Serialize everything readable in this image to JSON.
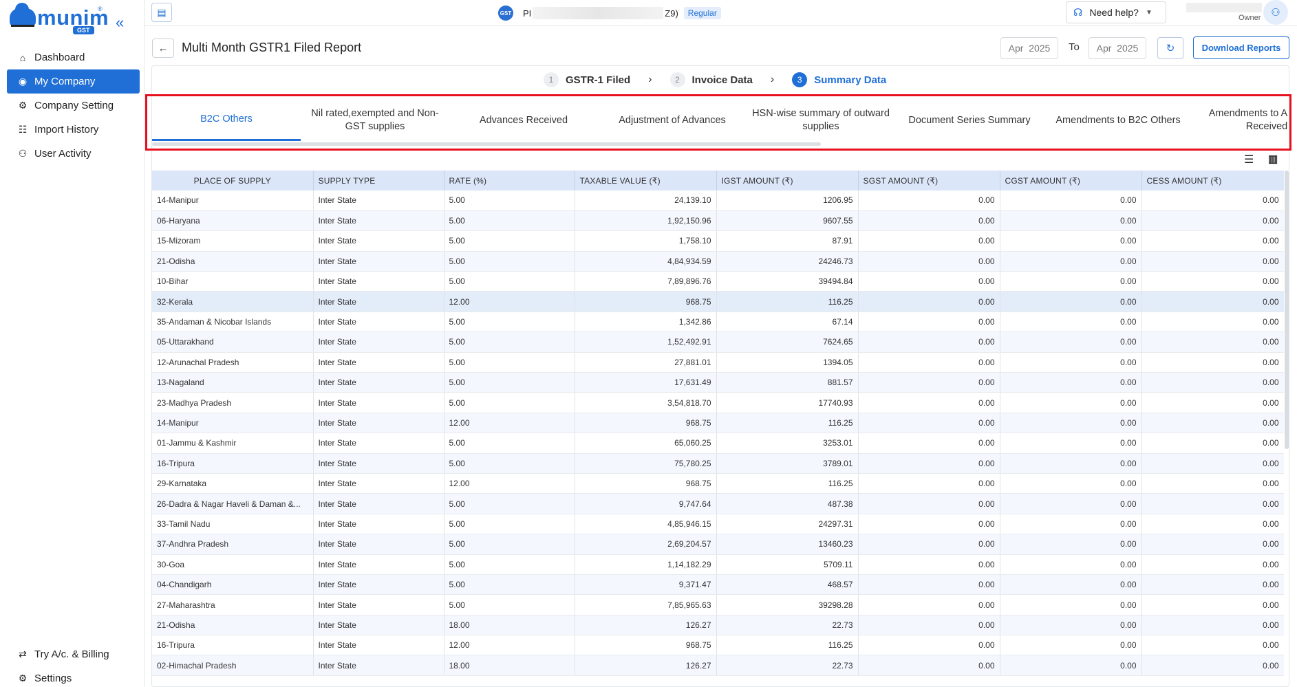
{
  "sidebar": {
    "logo_word": "munim",
    "logo_badge": "GST",
    "logo_reg": "®",
    "collapse_icon": "«",
    "items": [
      {
        "label": "Dashboard",
        "icon": "home-icon"
      },
      {
        "label": "My Company",
        "icon": "eye-icon",
        "active": true
      },
      {
        "label": "Company Setting",
        "icon": "gear-icon"
      },
      {
        "label": "Import History",
        "icon": "database-icon"
      },
      {
        "label": "User Activity",
        "icon": "users-icon"
      }
    ],
    "bottom_items": [
      {
        "label": "Try A/c. & Billing",
        "icon": "switch-icon"
      },
      {
        "label": "Settings",
        "icon": "gear-icon"
      }
    ]
  },
  "topbar": {
    "company_prefix": "PI",
    "company_suffix": "Z9)",
    "badge": "Regular",
    "help_label": "Need help?",
    "role": "Owner"
  },
  "header": {
    "title": "Multi Month GSTR1 Filed Report",
    "from_month": "Apr",
    "from_year": "2025",
    "to_label": "To",
    "to_month": "Apr",
    "to_year": "2025",
    "download_label": "Download Reports"
  },
  "steps": [
    {
      "num": "1",
      "label": "GSTR-1 Filed"
    },
    {
      "num": "2",
      "label": "Invoice Data"
    },
    {
      "num": "3",
      "label": "Summary Data",
      "active": true
    }
  ],
  "tabs": [
    {
      "label": "B2C Others",
      "active": true
    },
    {
      "label": "Nil rated,exempted and Non-GST supplies"
    },
    {
      "label": "Advances Received"
    },
    {
      "label": "Adjustment of Advances"
    },
    {
      "label": "HSN-wise summary of outward supplies"
    },
    {
      "label": "Document Series Summary"
    },
    {
      "label": "Amendments to B2C Others"
    },
    {
      "label": "Amendments to Advances Received"
    }
  ],
  "table": {
    "columns": [
      "PLACE OF SUPPLY",
      "SUPPLY TYPE",
      "RATE (%)",
      "TAXABLE VALUE (₹)",
      "IGST AMOUNT (₹)",
      "SGST AMOUNT (₹)",
      "CGST AMOUNT (₹)",
      "CESS AMOUNT (₹)"
    ],
    "rows": [
      [
        "14-Manipur",
        "Inter State",
        "5.00",
        "24,139.10",
        "1206.95",
        "0.00",
        "0.00",
        "0.00"
      ],
      [
        "06-Haryana",
        "Inter State",
        "5.00",
        "1,92,150.96",
        "9607.55",
        "0.00",
        "0.00",
        "0.00"
      ],
      [
        "15-Mizoram",
        "Inter State",
        "5.00",
        "1,758.10",
        "87.91",
        "0.00",
        "0.00",
        "0.00"
      ],
      [
        "21-Odisha",
        "Inter State",
        "5.00",
        "4,84,934.59",
        "24246.73",
        "0.00",
        "0.00",
        "0.00"
      ],
      [
        "10-Bihar",
        "Inter State",
        "5.00",
        "7,89,896.76",
        "39494.84",
        "0.00",
        "0.00",
        "0.00"
      ],
      [
        "32-Kerala",
        "Inter State",
        "12.00",
        "968.75",
        "116.25",
        "0.00",
        "0.00",
        "0.00"
      ],
      [
        "35-Andaman & Nicobar Islands",
        "Inter State",
        "5.00",
        "1,342.86",
        "67.14",
        "0.00",
        "0.00",
        "0.00"
      ],
      [
        "05-Uttarakhand",
        "Inter State",
        "5.00",
        "1,52,492.91",
        "7624.65",
        "0.00",
        "0.00",
        "0.00"
      ],
      [
        "12-Arunachal Pradesh",
        "Inter State",
        "5.00",
        "27,881.01",
        "1394.05",
        "0.00",
        "0.00",
        "0.00"
      ],
      [
        "13-Nagaland",
        "Inter State",
        "5.00",
        "17,631.49",
        "881.57",
        "0.00",
        "0.00",
        "0.00"
      ],
      [
        "23-Madhya Pradesh",
        "Inter State",
        "5.00",
        "3,54,818.70",
        "17740.93",
        "0.00",
        "0.00",
        "0.00"
      ],
      [
        "14-Manipur",
        "Inter State",
        "12.00",
        "968.75",
        "116.25",
        "0.00",
        "0.00",
        "0.00"
      ],
      [
        "01-Jammu & Kashmir",
        "Inter State",
        "5.00",
        "65,060.25",
        "3253.01",
        "0.00",
        "0.00",
        "0.00"
      ],
      [
        "16-Tripura",
        "Inter State",
        "5.00",
        "75,780.25",
        "3789.01",
        "0.00",
        "0.00",
        "0.00"
      ],
      [
        "29-Karnataka",
        "Inter State",
        "12.00",
        "968.75",
        "116.25",
        "0.00",
        "0.00",
        "0.00"
      ],
      [
        "26-Dadra & Nagar Haveli & Daman &...",
        "Inter State",
        "5.00",
        "9,747.64",
        "487.38",
        "0.00",
        "0.00",
        "0.00"
      ],
      [
        "33-Tamil Nadu",
        "Inter State",
        "5.00",
        "4,85,946.15",
        "24297.31",
        "0.00",
        "0.00",
        "0.00"
      ],
      [
        "37-Andhra Pradesh",
        "Inter State",
        "5.00",
        "2,69,204.57",
        "13460.23",
        "0.00",
        "0.00",
        "0.00"
      ],
      [
        "30-Goa",
        "Inter State",
        "5.00",
        "1,14,182.29",
        "5709.11",
        "0.00",
        "0.00",
        "0.00"
      ],
      [
        "04-Chandigarh",
        "Inter State",
        "5.00",
        "9,371.47",
        "468.57",
        "0.00",
        "0.00",
        "0.00"
      ],
      [
        "27-Maharashtra",
        "Inter State",
        "5.00",
        "7,85,965.63",
        "39298.28",
        "0.00",
        "0.00",
        "0.00"
      ],
      [
        "21-Odisha",
        "Inter State",
        "18.00",
        "126.27",
        "22.73",
        "0.00",
        "0.00",
        "0.00"
      ],
      [
        "16-Tripura",
        "Inter State",
        "12.00",
        "968.75",
        "116.25",
        "0.00",
        "0.00",
        "0.00"
      ],
      [
        "02-Himachal Pradesh",
        "Inter State",
        "18.00",
        "126.27",
        "22.73",
        "0.00",
        "0.00",
        "0.00"
      ]
    ],
    "selected_row": 5
  },
  "colors": {
    "accent": "#1f6fd6",
    "highlight_frame": "#e8101d",
    "header_bg": "#dbe6f9"
  }
}
